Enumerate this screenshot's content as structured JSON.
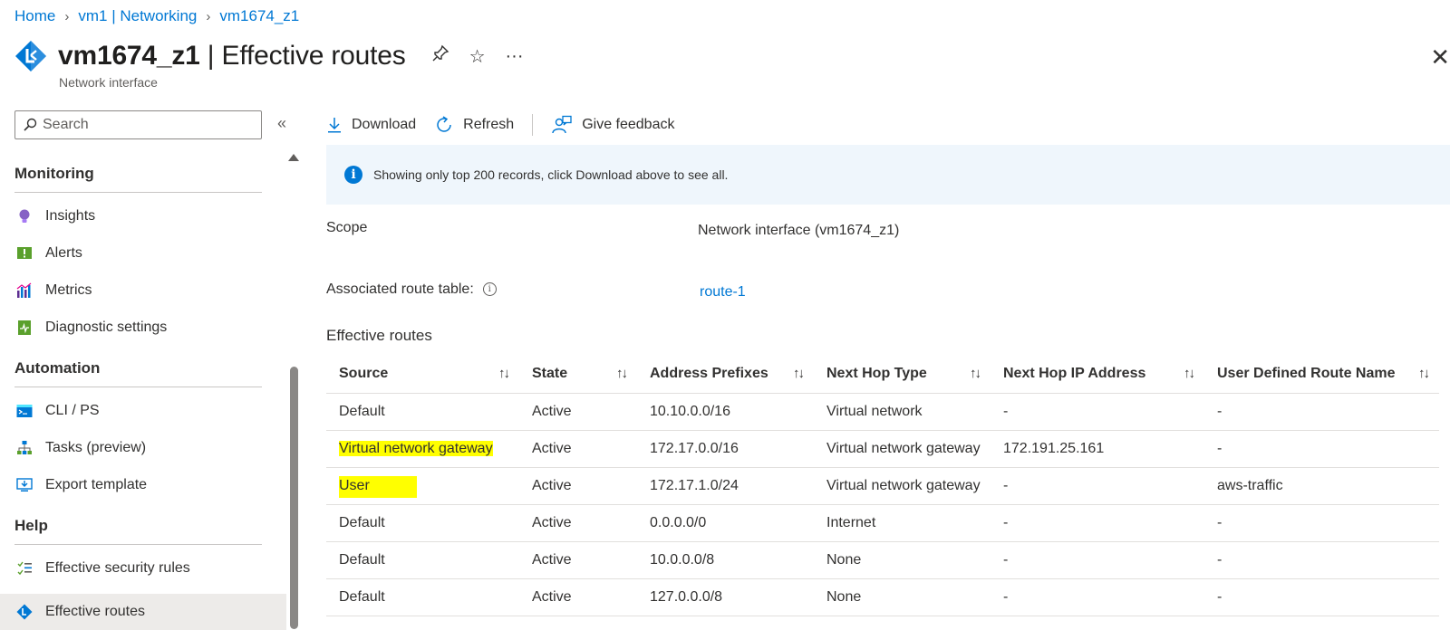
{
  "breadcrumb": [
    {
      "label": "Home"
    },
    {
      "label": "vm1 | Networking"
    },
    {
      "label": "vm1674_z1"
    }
  ],
  "title": {
    "resource": "vm1674_z1",
    "separator": " | ",
    "blade": "Effective routes",
    "subtitle": "Network interface"
  },
  "title_actions": {
    "pin": "⤴",
    "favorite": "☆",
    "more": "···",
    "close": "✕"
  },
  "sidebar": {
    "search_placeholder": "Search",
    "collapse": "«",
    "sections": [
      {
        "heading": "Monitoring",
        "items": [
          {
            "label": "Insights",
            "icon": "lightbulb-icon"
          },
          {
            "label": "Alerts",
            "icon": "alerts-icon"
          },
          {
            "label": "Metrics",
            "icon": "metrics-icon"
          },
          {
            "label": "Diagnostic settings",
            "icon": "diagnostic-icon"
          }
        ]
      },
      {
        "heading": "Automation",
        "items": [
          {
            "label": "CLI / PS",
            "icon": "terminal-icon"
          },
          {
            "label": "Tasks (preview)",
            "icon": "tasks-icon"
          },
          {
            "label": "Export template",
            "icon": "export-icon"
          }
        ]
      },
      {
        "heading": "Help",
        "items": [
          {
            "label": "Effective security rules",
            "icon": "security-rules-icon"
          },
          {
            "label": "Effective routes",
            "icon": "routes-icon",
            "active": true
          }
        ]
      }
    ]
  },
  "toolbar": {
    "download": "Download",
    "refresh": "Refresh",
    "feedback": "Give feedback"
  },
  "info": {
    "message": "Showing only top 200 records, click Download above to see all."
  },
  "scope": {
    "label": "Scope",
    "value": "Network interface (vm1674_z1)"
  },
  "route_table": {
    "label": "Associated route table:",
    "value": "route-1"
  },
  "routes": {
    "heading": "Effective routes",
    "columns": [
      "Source",
      "State",
      "Address Prefixes",
      "Next Hop Type",
      "Next Hop IP Address",
      "User Defined Route Name"
    ],
    "sort_glyph": "↑↓",
    "rows": [
      [
        "Default",
        "Active",
        "10.10.0.0/16",
        "Virtual network",
        "-",
        "-"
      ],
      [
        "Virtual network gateway",
        "Active",
        "172.17.0.0/16",
        "Virtual network gateway",
        "172.191.25.161",
        "-"
      ],
      [
        "User",
        "Active",
        "172.17.1.0/24",
        "Virtual network gateway",
        "-",
        "aws-traffic"
      ],
      [
        "Default",
        "Active",
        "0.0.0.0/0",
        "Internet",
        "-",
        "-"
      ],
      [
        "Default",
        "Active",
        "10.0.0.0/8",
        "None",
        "-",
        "-"
      ],
      [
        "Default",
        "Active",
        "127.0.0.0/8",
        "None",
        "-",
        "-"
      ]
    ]
  },
  "colors": {
    "accent": "#0078d4",
    "highlight": "#ffff00",
    "info_background": "#eff6fc"
  }
}
